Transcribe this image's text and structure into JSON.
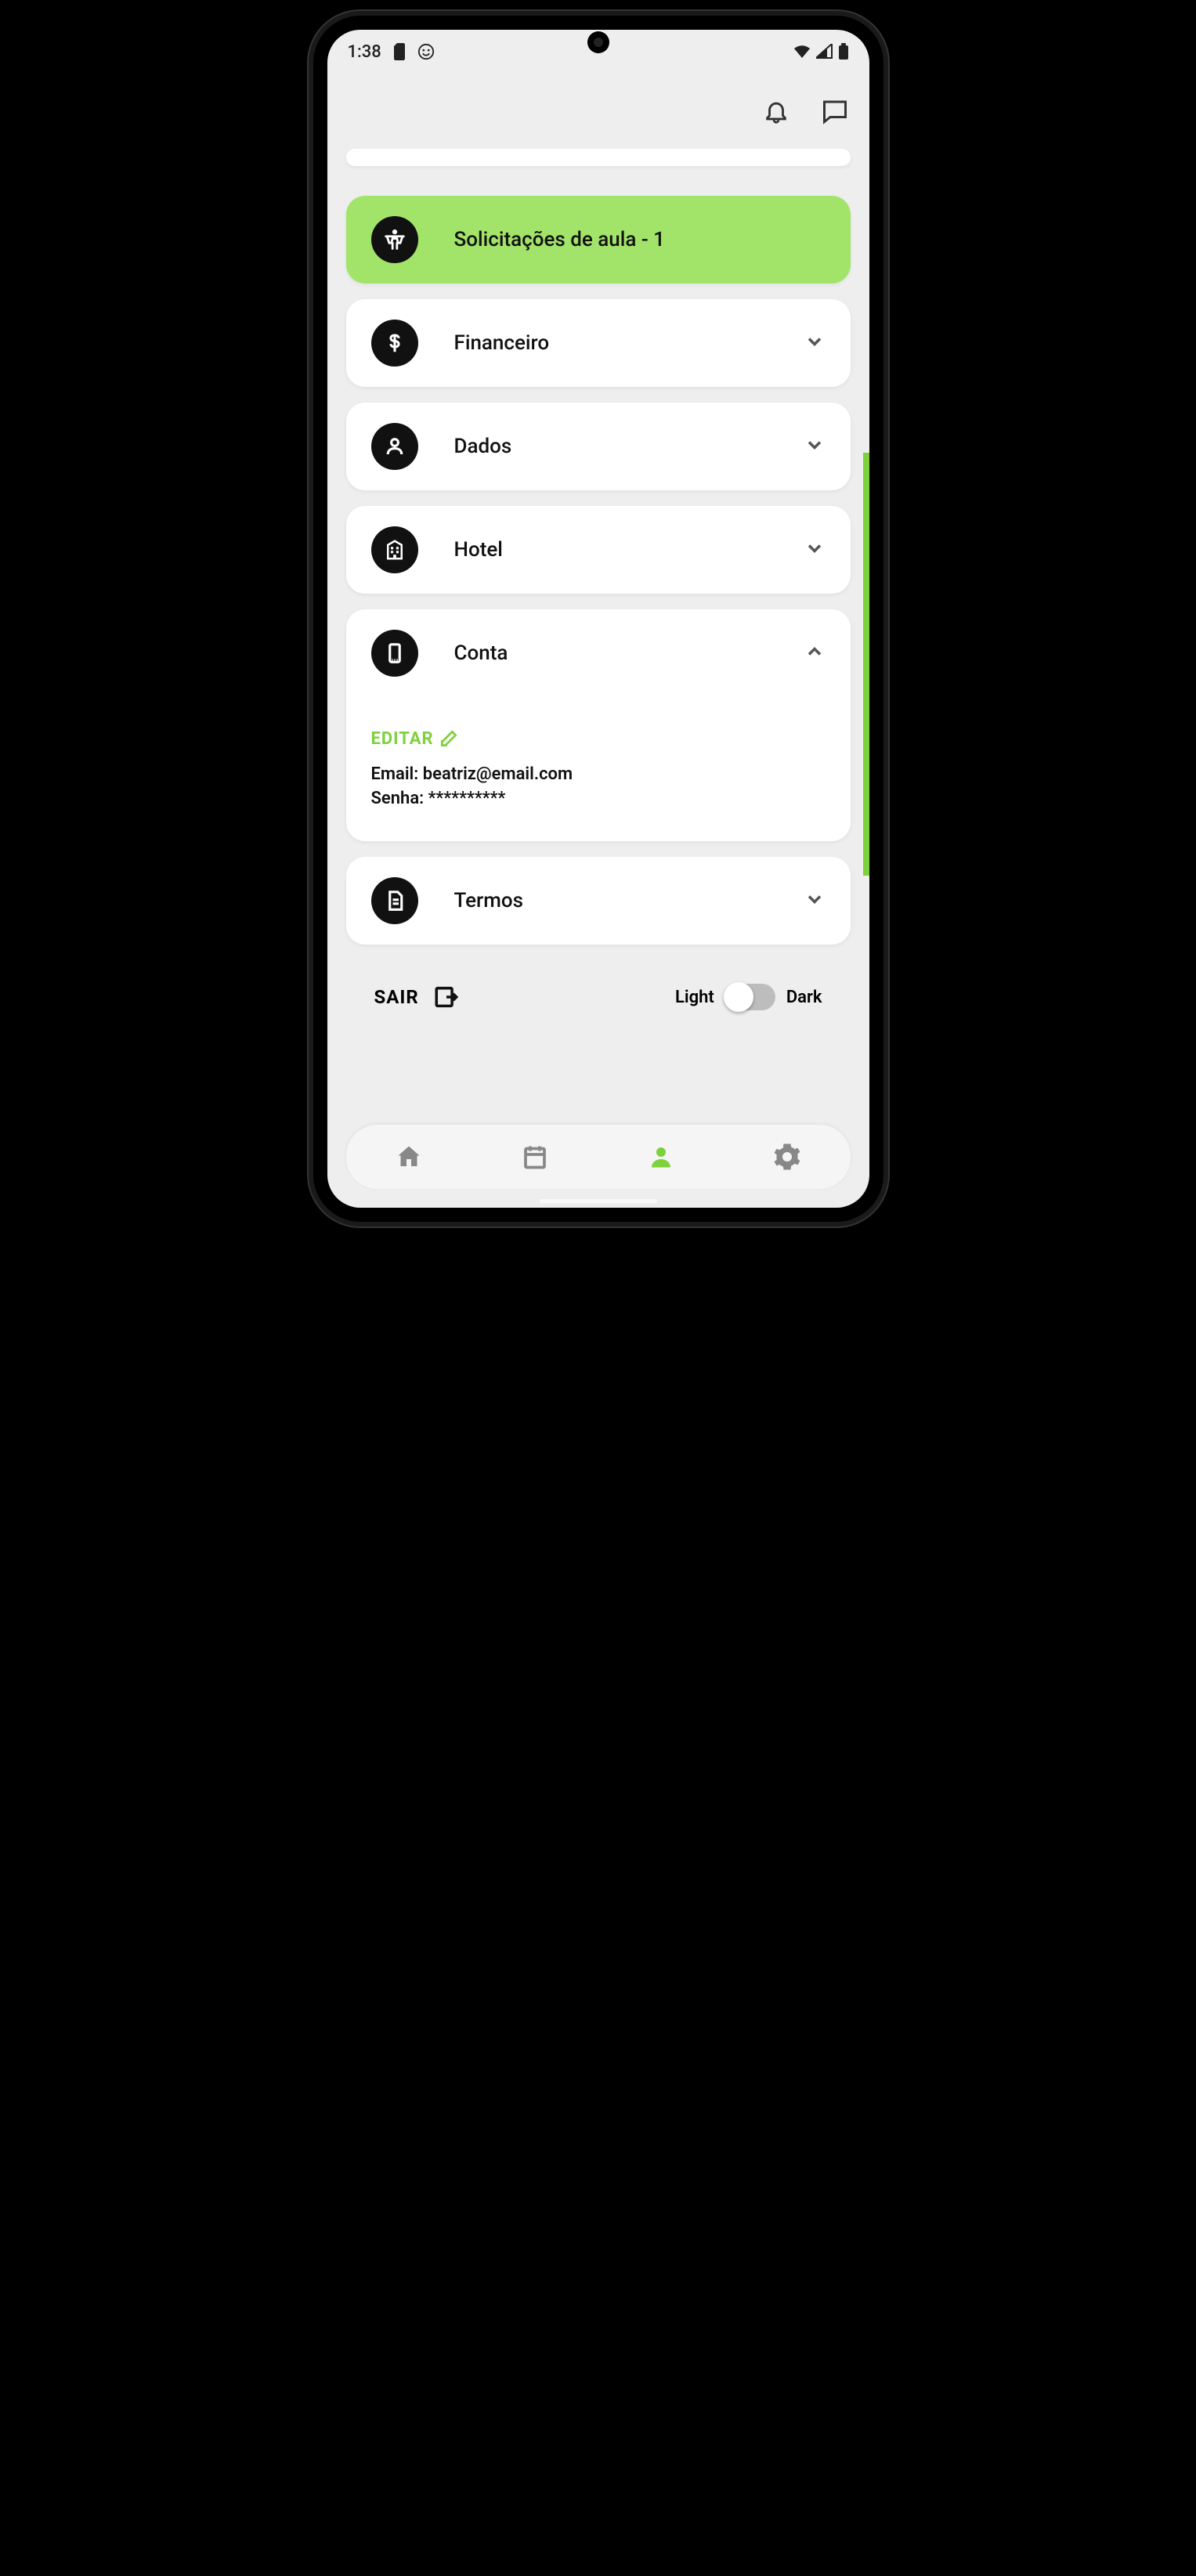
{
  "status": {
    "time": "1:38"
  },
  "menu": {
    "requests": {
      "label": "Solicitações de aula - 1"
    },
    "financial": {
      "label": "Financeiro"
    },
    "data": {
      "label": "Dados"
    },
    "hotel": {
      "label": "Hotel"
    },
    "account": {
      "label": "Conta",
      "edit": "EDITAR",
      "email_label": "Email:",
      "email_value": "beatriz@email.com",
      "password_label": "Senha:",
      "password_value": "**********"
    },
    "terms": {
      "label": "Termos"
    }
  },
  "footer": {
    "logout": "SAIR",
    "theme_light": "Light",
    "theme_dark": "Dark"
  },
  "colors": {
    "accent_green": "#7DD13B",
    "card_green": "#A2E46A"
  }
}
